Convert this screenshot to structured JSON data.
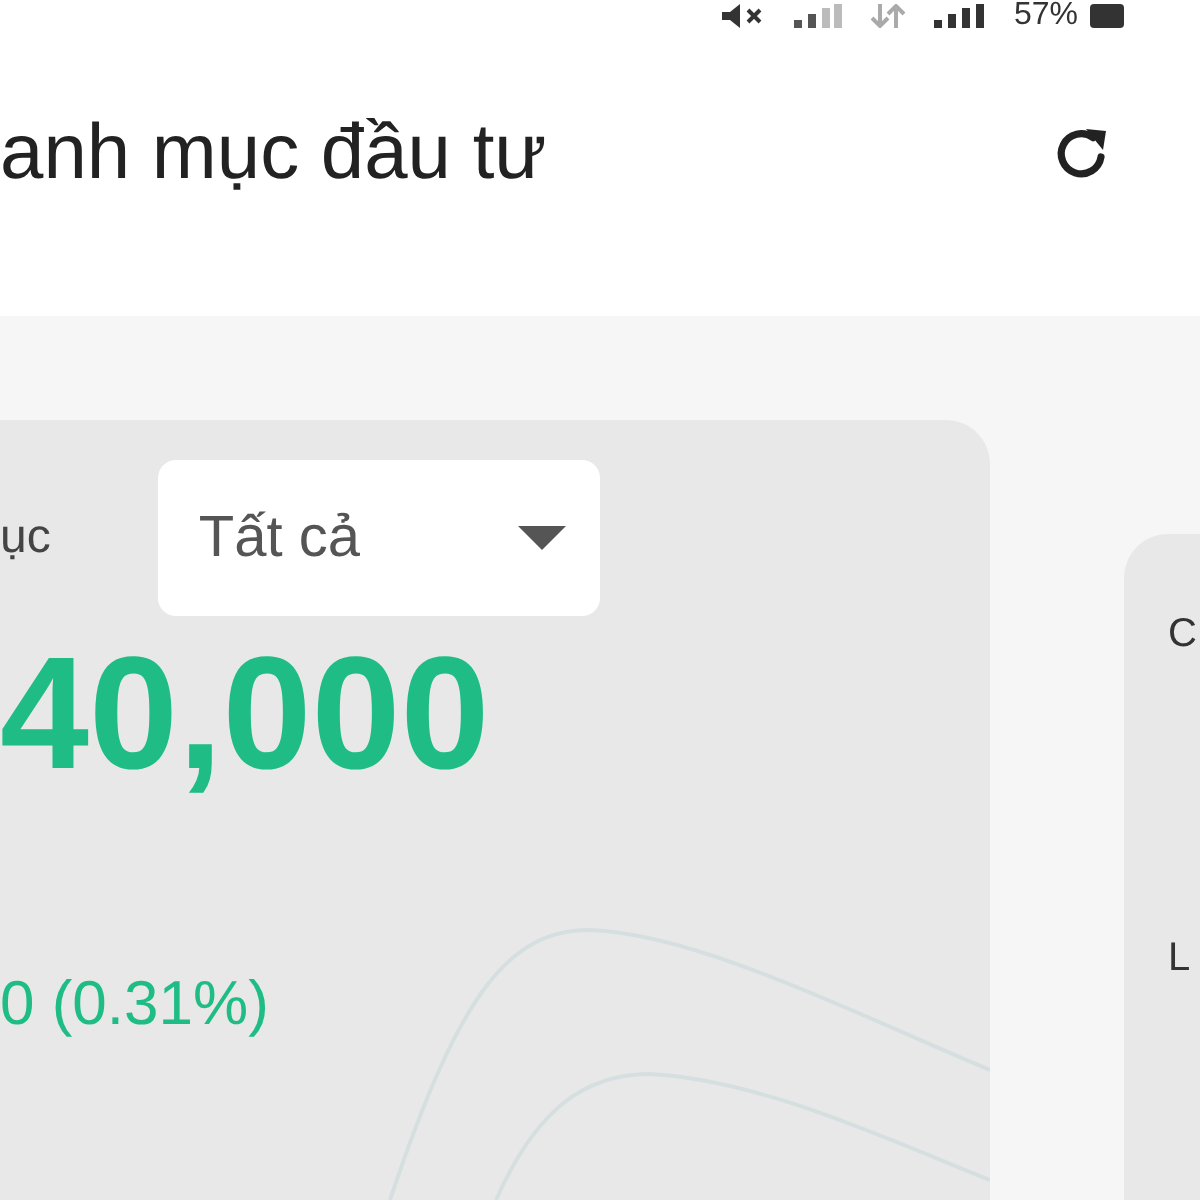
{
  "status_bar": {
    "battery_percent": "57%"
  },
  "header": {
    "title": "anh mục đầu tư"
  },
  "portfolio_card": {
    "label": "ục",
    "filter": {
      "value": "Tất cả"
    },
    "total_value": "40,000",
    "change": "0 (0.31%)"
  },
  "side_card": {
    "lines": [
      "C",
      "L"
    ]
  }
}
